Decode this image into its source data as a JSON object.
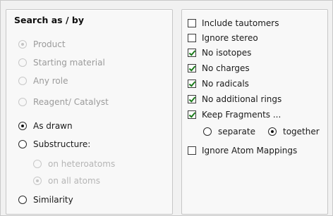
{
  "search_by": {
    "title": "Search as / by",
    "role_options": [
      {
        "label": "Product",
        "checked": true,
        "enabled": false
      },
      {
        "label": "Starting material",
        "checked": false,
        "enabled": false
      },
      {
        "label": "Any role",
        "checked": false,
        "enabled": false
      },
      {
        "label": "Reagent/ Catalyst",
        "checked": false,
        "enabled": false
      }
    ],
    "mode_options": [
      {
        "label": "As drawn",
        "checked": true,
        "enabled": true
      },
      {
        "label": "Substructure:",
        "checked": false,
        "enabled": true
      }
    ],
    "substructure_options": [
      {
        "label": "on heteroatoms",
        "checked": false,
        "enabled": false
      },
      {
        "label": "on all atoms",
        "checked": true,
        "enabled": false
      }
    ],
    "similarity": {
      "label": "Similarity",
      "checked": false,
      "enabled": true
    }
  },
  "options": {
    "checkboxes": [
      {
        "label": "Include tautomers",
        "checked": false
      },
      {
        "label": "Ignore stereo",
        "checked": false
      },
      {
        "label": "No isotopes",
        "checked": true
      },
      {
        "label": "No charges",
        "checked": true
      },
      {
        "label": "No radicals",
        "checked": true
      },
      {
        "label": "No additional rings",
        "checked": true
      },
      {
        "label": "Keep Fragments ...",
        "checked": true
      }
    ],
    "fragment_modes": [
      {
        "label": "separate",
        "checked": false
      },
      {
        "label": "together",
        "checked": true
      }
    ],
    "ignore_mappings": {
      "label": "Ignore Atom Mappings",
      "checked": false
    }
  },
  "colors": {
    "check_mark": "#1a7a1a",
    "disabled_text": "#9b9b9b"
  }
}
